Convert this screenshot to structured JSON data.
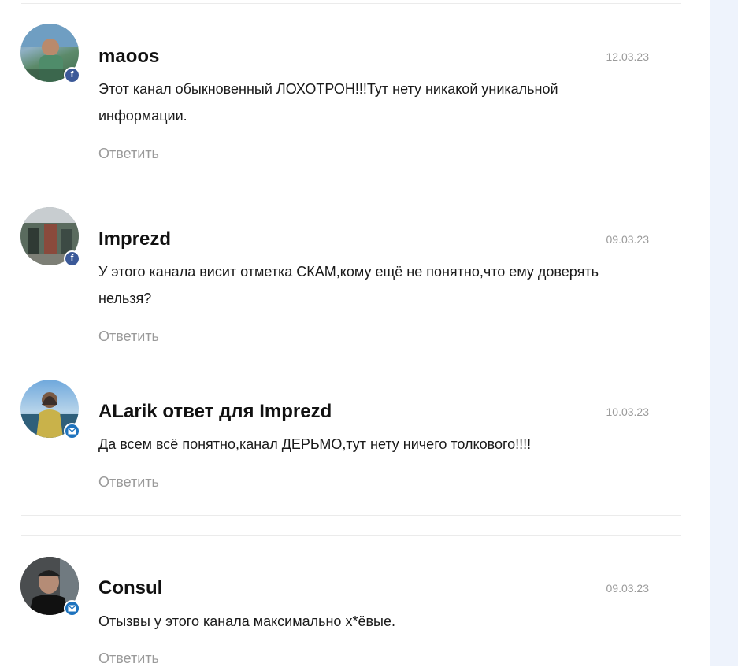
{
  "comments": [
    {
      "author": "maoos",
      "date": "12.03.23",
      "text": "Этот канал обыкновенный ЛОХОТРОН!!!Тут нету никакой уникальной информации.",
      "reply_label": "Ответить",
      "badge": "facebook-icon"
    },
    {
      "author": "Imprezd",
      "date": "09.03.23",
      "text": "У этого канала висит отметка СКАМ,кому ещё не понятно,что ему доверять нельзя?",
      "reply_label": "Ответить",
      "badge": "facebook-icon"
    },
    {
      "author": "ALarik ответ для Imprezd",
      "date": "10.03.23",
      "text": "Да всем всё понятно,канал ДЕРЬМО,тут нету ничего толкового!!!!",
      "reply_label": "Ответить",
      "badge": "mail-icon"
    },
    {
      "author": "Consul",
      "date": "09.03.23",
      "text": "Отызвы у этого канала максимально х*ёвые.",
      "reply_label": "Ответить",
      "badge": "mail-icon"
    }
  ],
  "colors": {
    "text": "#1a1a1a",
    "muted": "#9a9a9a",
    "facebook": "#3b5998",
    "mail": "#1e73be",
    "side_panel": "#eef3fc"
  }
}
